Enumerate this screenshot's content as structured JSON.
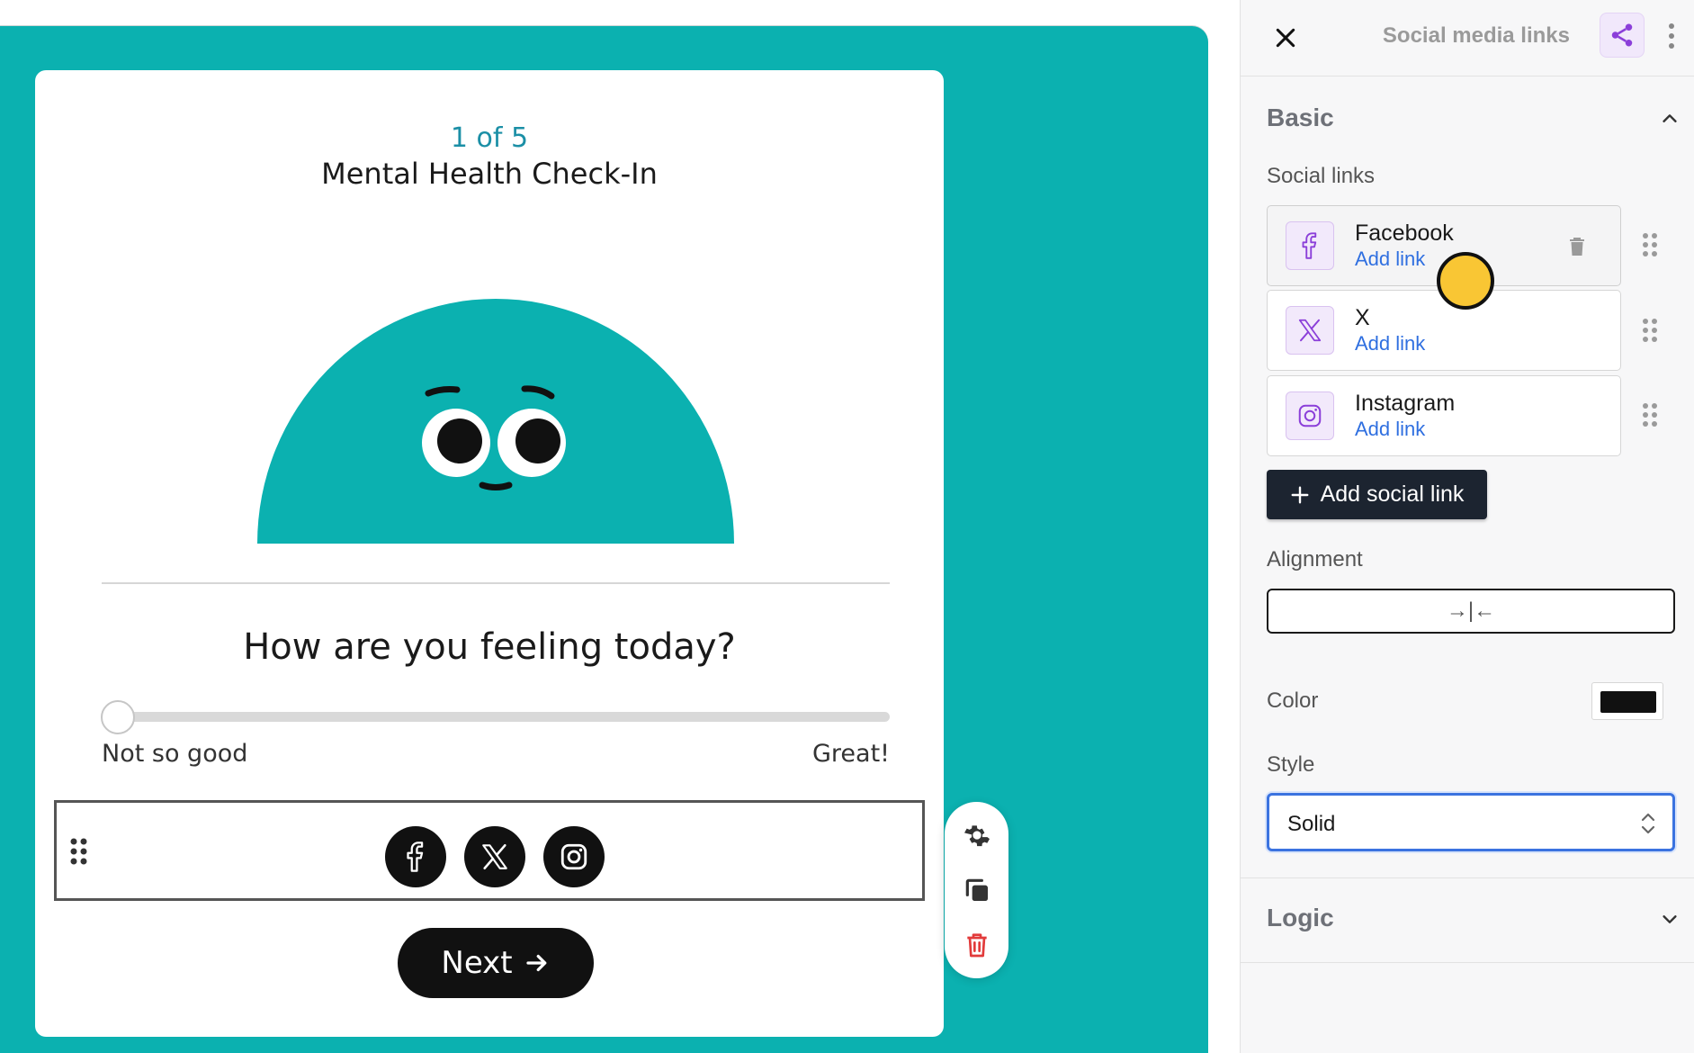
{
  "survey": {
    "progress": "1 of 5",
    "title": "Mental Health Check-In",
    "question": "How are you feeling today?",
    "slider": {
      "min_label": "Not so good",
      "max_label": "Great!",
      "value_fraction": 0
    },
    "social_icons": [
      "facebook-icon",
      "x-icon",
      "instagram-icon"
    ],
    "next_label": "Next",
    "background_color": "#0bb1b0"
  },
  "toolbar": {
    "tools": [
      "gear-icon",
      "copy-icon",
      "trash-icon"
    ]
  },
  "panel": {
    "title": "Social media links",
    "basic": {
      "title": "Basic",
      "social_links_label": "Social links",
      "links": [
        {
          "name": "Facebook",
          "action": "Add link",
          "icon": "facebook-icon"
        },
        {
          "name": "X",
          "action": "Add link",
          "icon": "x-icon"
        },
        {
          "name": "Instagram",
          "action": "Add link",
          "icon": "instagram-icon"
        }
      ],
      "add_button": "Add social link",
      "alignment_label": "Alignment",
      "alignment_value": "→|←",
      "color_label": "Color",
      "color_value": "#111111",
      "style_label": "Style",
      "style_value": "Solid"
    },
    "logic": {
      "title": "Logic"
    },
    "accent_color": "#8b3fd9",
    "link_color": "#2f6fe0"
  }
}
